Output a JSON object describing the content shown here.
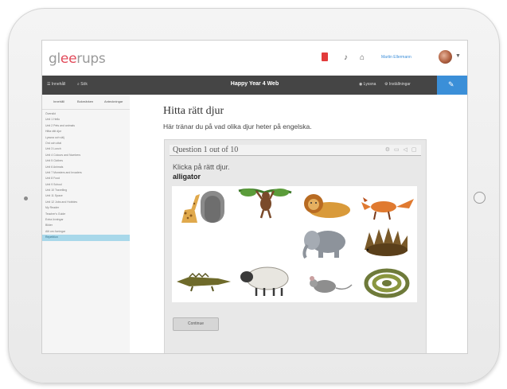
{
  "topbar": {
    "logo_prefix": "gl",
    "logo_accent": "ee",
    "logo_suffix": "rups",
    "icons": [
      "bookmark-icon",
      "bell-icon",
      "home-icon"
    ],
    "username": "Martin Ellermann"
  },
  "navbar": {
    "left_label": "Innehåll",
    "search_label": "Sök",
    "title": "Happy Year 4 Web",
    "right_label_1": "Lyssna",
    "right_label_2": "Inställningar",
    "blue_icon": "edit-icon"
  },
  "sidebar": {
    "tabs": [
      "Innehåll",
      "Bokmärken",
      "Anteckningar"
    ],
    "items": [
      "Översikt",
      "Unit 1 Hello",
      "Unit 2 Pets and animals",
      "Hitta rätt djur",
      "Lyssna och välj",
      "Ord och uttal",
      "Unit 3 Lunch",
      "Unit 4 Colours and Numbers",
      "Unit 5 Clothes",
      "Unit 6 Animals",
      "Unit 7 Monsters and Invaders",
      "Unit 8 Food",
      "Unit 9 School",
      "Unit 10 Travelling",
      "Unit 11 Space",
      "Unit 12 Jobs and Hobbies",
      "My Reader",
      "Teacher's Guide",
      "Extra övningar",
      "Bilder",
      "Allt om övningar",
      "Repetition"
    ],
    "selected_index": 21
  },
  "main": {
    "page_title": "Hitta rätt djur",
    "page_subtitle": "Här tränar du på vad olika djur heter på engelska."
  },
  "quiz": {
    "header": "Question 1 out of 10",
    "tool_icons": "⚙ ▭ ◁ ▢",
    "instruction": "Klicka på rätt djur.",
    "word": "alligator",
    "animals": [
      "giraffe",
      "monkey",
      "lion",
      "fox",
      "elephant",
      "hedgehog",
      "crocodile",
      "sheep",
      "mouse",
      "snake"
    ],
    "next_label": "Continue"
  },
  "colors": {
    "nav_bg": "#454545",
    "accent_blue": "#3b8fd8",
    "bookmark_red": "#e23b3b",
    "selected_item": "#a8d8ea"
  }
}
